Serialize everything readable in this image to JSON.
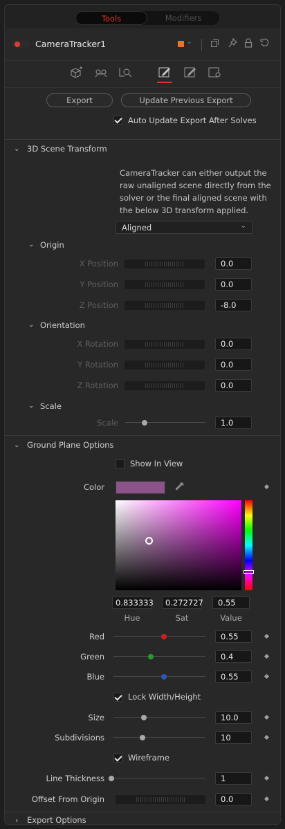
{
  "tabs": {
    "tools": "Tools",
    "modifiers": "Modifiers"
  },
  "node": {
    "name": "CameraTracker1",
    "color_swatch": "#e8742c"
  },
  "header_icons": [
    "color-dropdown-icon",
    "versions-icon",
    "pin-icon",
    "lock-icon",
    "reset-icon"
  ],
  "tool_tabs": [
    "track-tab-icon",
    "camera-tab-icon",
    "solve-tab-icon",
    "export-tab-icon",
    "options-tab-icon",
    "settings-tab-icon"
  ],
  "export": {
    "export_label": "Export",
    "update_label": "Update Previous Export",
    "auto_update_label": "Auto Update Export After Solves",
    "auto_update_checked": true
  },
  "scene_transform": {
    "title": "3D Scene Transform",
    "description": "CameraTracker can either output the raw unaligned scene directly from the solver or the final aligned scene with the below 3D transform applied.",
    "mode": "Aligned",
    "origin": {
      "title": "Origin",
      "x_label": "X Position",
      "x_value": "0.0",
      "y_label": "Y Position",
      "y_value": "0.0",
      "z_label": "Z Position",
      "z_value": "-8.0"
    },
    "orientation": {
      "title": "Orientation",
      "x_label": "X Rotation",
      "x_value": "0.0",
      "y_label": "Y Rotation",
      "y_value": "0.0",
      "z_label": "Z Rotation",
      "z_value": "0.0"
    },
    "scale": {
      "title": "Scale",
      "label": "Scale",
      "value": "1.0",
      "slider_fraction": 0.22
    }
  },
  "ground_plane": {
    "title": "Ground Plane Options",
    "show_in_view_label": "Show In View",
    "show_in_view_checked": false,
    "color_label": "Color",
    "color_hex": "#8b5389",
    "hue_value": "0.833333",
    "hue_label": "Hue",
    "sat_value": "0.272727",
    "sat_label": "Sat",
    "val_value": "0.55",
    "val_label": "Value",
    "red_label": "Red",
    "red_value": "0.55",
    "red_fraction": 0.55,
    "green_label": "Green",
    "green_value": "0.4",
    "green_fraction": 0.4,
    "blue_label": "Blue",
    "blue_value": "0.55",
    "blue_fraction": 0.55,
    "lock_label": "Lock Width/Height",
    "lock_checked": true,
    "size_label": "Size",
    "size_value": "10.0",
    "size_fraction": 0.32,
    "subdiv_label": "Subdivisions",
    "subdiv_value": "10",
    "subdiv_fraction": 0.3,
    "wireframe_label": "Wireframe",
    "wireframe_checked": true,
    "thickness_label": "Line Thickness",
    "thickness_value": "1",
    "thickness_fraction": 0.0,
    "offset_label": "Offset From Origin",
    "offset_value": "0.0"
  },
  "export_options": {
    "title": "Export Options"
  },
  "colors": {
    "accent_red": "#e0322b",
    "red_knob": "#d11f1f",
    "green_knob": "#2a9a2a",
    "blue_knob": "#2a5ab8"
  }
}
